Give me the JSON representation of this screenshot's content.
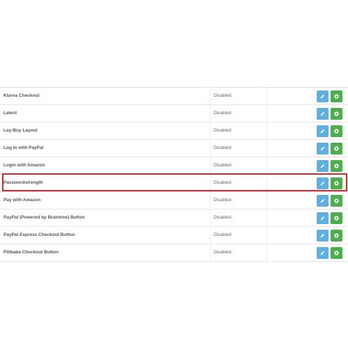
{
  "extensions": [
    {
      "name": "Klarna Checkout",
      "status": "Disabled"
    },
    {
      "name": "Latest",
      "status": "Disabled"
    },
    {
      "name": "Lay-Buy Layout",
      "status": "Disabled"
    },
    {
      "name": "Log In with PayPal",
      "status": "Disabled"
    },
    {
      "name": "Login with Amazon",
      "status": "Disabled"
    },
    {
      "name": "Passwordstrength",
      "status": "Disabled"
    },
    {
      "name": "Pay with Amazon",
      "status": "Disabled"
    },
    {
      "name": "PayPal (Powered by Braintree) Button",
      "status": "Disabled"
    },
    {
      "name": "PayPal Express Checkout Button",
      "status": "Disabled"
    },
    {
      "name": "Pilibaba Checkout Button",
      "status": "Disabled"
    }
  ],
  "icons": {
    "edit": "pencil-icon",
    "install": "plus-circle-icon"
  },
  "colors": {
    "edit_button": "#5fb0de",
    "install_button": "#4cae4c",
    "highlight": "#d9262a"
  }
}
